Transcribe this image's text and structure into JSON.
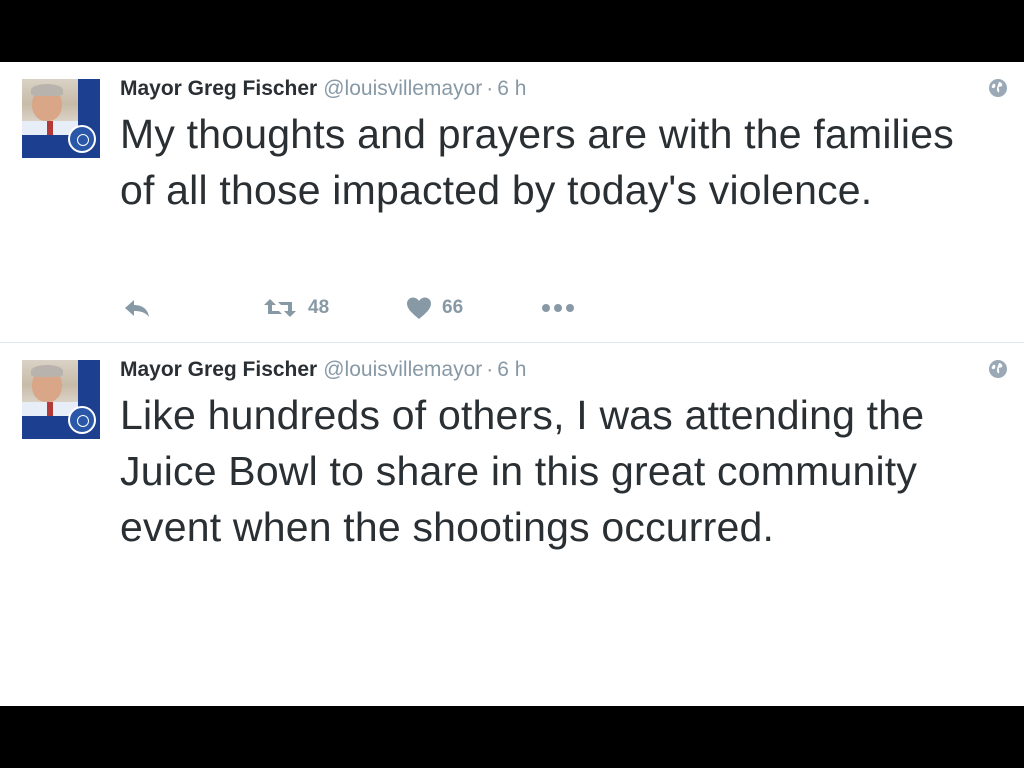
{
  "tweets": [
    {
      "name": "Mayor Greg Fischer",
      "handle": "@louisvillemayor",
      "separator": "·",
      "time": "6 h",
      "text": "My thoughts and prayers are with the families of all those impacted by today's violence.",
      "actions": {
        "reply_icon": "reply-icon",
        "retweet_icon": "retweet-icon",
        "retweet_count": "48",
        "like_icon": "heart-icon",
        "like_count": "66",
        "more_icon": "more-dots-icon"
      }
    },
    {
      "name": "Mayor Greg Fischer",
      "handle": "@louisvillemayor",
      "separator": "·",
      "time": "6 h",
      "text": "Like hundreds of others, I was attending the Juice Bowl to share in this great community event when the shootings occurred."
    }
  ],
  "colors": {
    "text": "#292f33",
    "muted": "#8899a6",
    "avatar_bg": "#1c3f8f",
    "divider": "#e1e8ed"
  }
}
